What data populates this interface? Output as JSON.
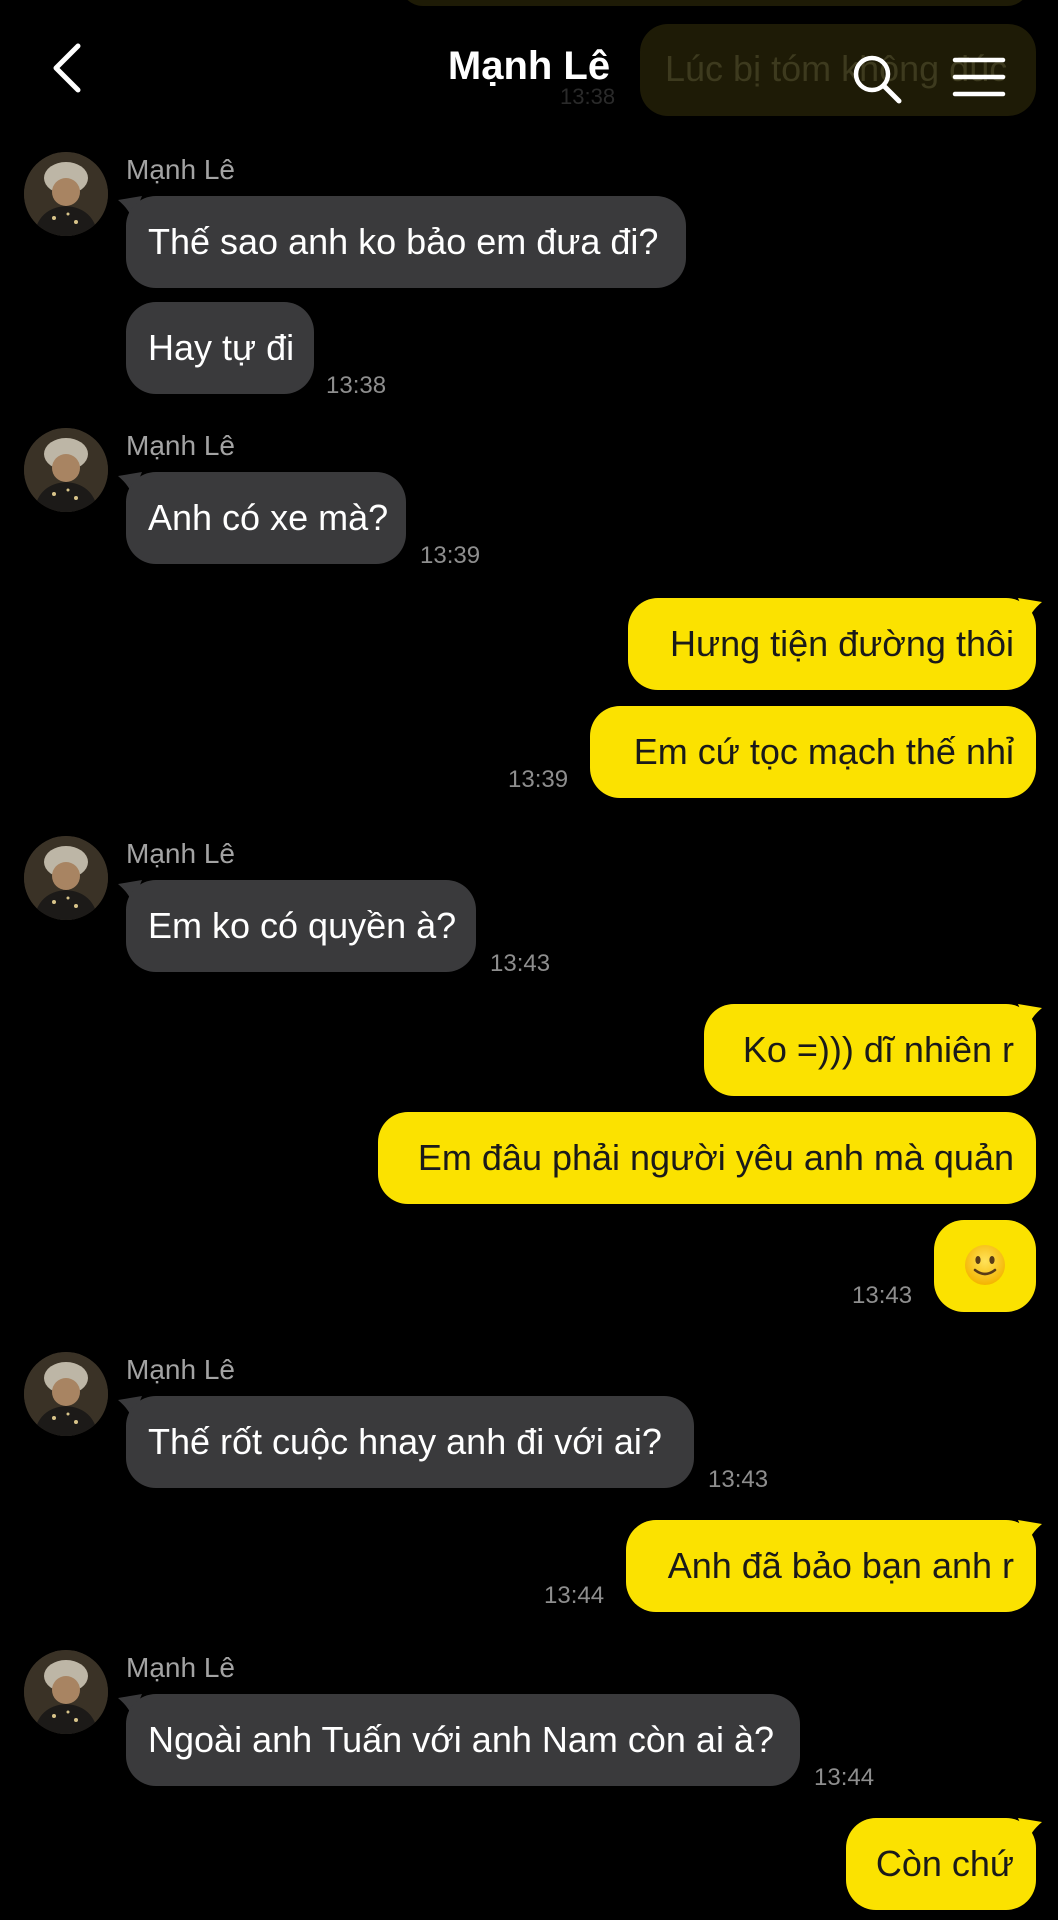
{
  "header": {
    "title": "Mạnh Lê",
    "ghost_text": "Lúc bị tóm không đúc",
    "ghost_time": "13:38"
  },
  "messages": {
    "m1": {
      "sender": "Mạnh Lê",
      "text1": "Thế sao anh ko bảo em đưa đi?",
      "text2": "Hay tự đi",
      "time": "13:38"
    },
    "m2": {
      "sender": "Mạnh Lê",
      "text": "Anh có xe mà?",
      "time": "13:39"
    },
    "m3": {
      "text1": "Hưng tiện đường thôi",
      "text2": "Em cứ tọc mạch thế nhỉ",
      "time": "13:39"
    },
    "m4": {
      "sender": "Mạnh Lê",
      "text": "Em ko có quyền à?",
      "time": "13:43"
    },
    "m5": {
      "text1": "Ko =))) dĩ nhiên r",
      "text2": "Em đâu phải người yêu anh mà quản",
      "emoji": "slightly-smiling-face",
      "time": "13:43"
    },
    "m6": {
      "sender": "Mạnh Lê",
      "text": "Thế rốt cuộc hnay anh đi với ai?",
      "time": "13:43"
    },
    "m7": {
      "text": "Anh đã bảo bạn anh r",
      "time": "13:44"
    },
    "m8": {
      "sender": "Mạnh Lê",
      "text": "Ngoài anh Tuấn với anh Nam còn ai à?",
      "time": "13:44"
    },
    "m9": {
      "text": "Còn chứ"
    }
  },
  "colors": {
    "background": "#000000",
    "incoming_bubble": "#3a3a3c",
    "outgoing_bubble": "#fbe200",
    "timestamp": "#8e8e8e"
  }
}
